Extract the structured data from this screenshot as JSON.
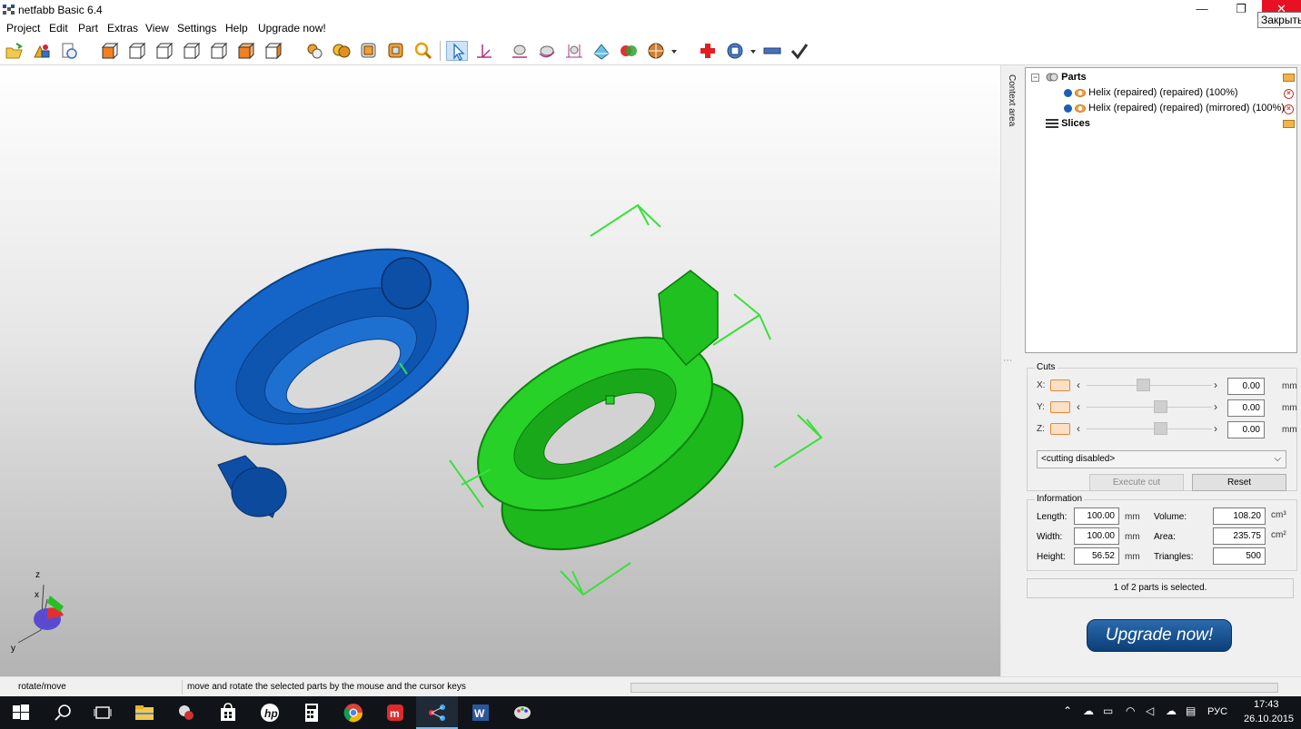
{
  "window": {
    "title": "netfabb Basic 6.4",
    "controls": {
      "minimize": "—",
      "maximize": "❐",
      "close": "✕"
    },
    "close_tooltip": "Закрыть"
  },
  "menu": [
    "Project",
    "Edit",
    "Part",
    "Extras",
    "View",
    "Settings",
    "Help",
    "Upgrade now!"
  ],
  "toolbar": {
    "icons": [
      "open-project-icon",
      "add-part-icon",
      "open-file-icon",
      "view-front-icon",
      "view-back-icon",
      "view-left-icon",
      "view-right-icon",
      "view-top-icon",
      "view-bottom-icon",
      "view-perspective-icon",
      "view-shaded-icon",
      "view-wireframe-icon",
      "view-transparent-icon",
      "zoom-icon",
      "select-tool-icon",
      "measure-axes-icon",
      "move-icon",
      "rotate-icon",
      "scale-icon",
      "mirror-icon",
      "merge-icon",
      "texture-icon",
      "repair-icon",
      "analysis-icon",
      "ruler-icon",
      "apply-check-icon"
    ],
    "selected": "select-tool-icon"
  },
  "context_area_label": "Context area",
  "tree": {
    "parts_label": "Parts",
    "slices_label": "Slices",
    "items": [
      {
        "label": "Helix (repaired) (repaired) (100%)",
        "color": "#1a5fb4"
      },
      {
        "label": "Helix (repaired) (repaired) (mirrored) (100%)",
        "color": "#1a5fb4"
      }
    ]
  },
  "cuts": {
    "title": "Cuts",
    "unit": "mm",
    "rows": [
      {
        "axis": "X:",
        "value": "0.00",
        "level": 0.45
      },
      {
        "axis": "Y:",
        "value": "0.00",
        "level": 0.6
      },
      {
        "axis": "Z:",
        "value": "0.00",
        "level": 0.6
      }
    ],
    "mode": "<cutting disabled>",
    "execute_label": "Execute cut",
    "reset_label": "Reset"
  },
  "information": {
    "title": "Information",
    "length_label": "Length:",
    "length": "100.00",
    "width_label": "Width:",
    "width": "100.00",
    "height_label": "Height:",
    "height": "56.52",
    "length_unit": "mm",
    "volume_label": "Volume:",
    "volume": "108.20",
    "volume_unit": "cm³",
    "area_label": "Area:",
    "area": "235.75",
    "area_unit": "cm²",
    "triangles_label": "Triangles:",
    "triangles": "500"
  },
  "selection_status": "1 of 2 parts is selected.",
  "upgrade_button": "Upgrade now!",
  "axes": {
    "z": "z",
    "x": "x",
    "y": "y"
  },
  "statusbar": {
    "mode": "rotate/move",
    "hint": "move and rotate the selected parts by the mouse and the cursor keys"
  },
  "colors": {
    "part_blue": "#1565c8",
    "part_green": "#22d322",
    "selection_bracket": "#39e039",
    "close_red": "#e81123",
    "taskbar": "#101418"
  },
  "taskbar": {
    "apps": [
      "start-icon",
      "search-icon",
      "task-view-icon",
      "file-explorer-icon",
      "app-icon",
      "store-icon",
      "hp-icon",
      "calculator-icon",
      "chrome-icon",
      "app-red-icon",
      "netfabb-icon",
      "word-icon",
      "paint-icon"
    ],
    "language": "РУС",
    "time": "17:43",
    "date": "26.10.2015"
  }
}
